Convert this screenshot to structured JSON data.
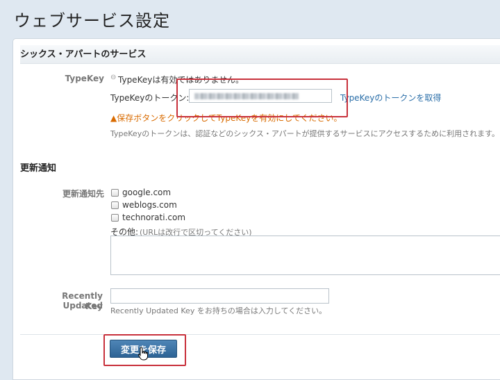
{
  "page": {
    "title": "ウェブサービス設定"
  },
  "six_apart": {
    "section_title": "シックス・アパートのサービス",
    "typekey_label": "TypeKey",
    "status_text": "TypeKeyは有効ではありません。",
    "token_label": "TypeKeyのトークン:",
    "get_token_link": "TypeKeyのトークンを取得",
    "warning": "▲保存ボタンをクリックしてTypeKeyを有効にしてください。",
    "description": "TypeKeyのトークンは、認証などのシックス・アパートが提供するサービスにアクセスするために利用されます。"
  },
  "update_ping": {
    "section_title": "更新通知",
    "services_label": "更新通知先",
    "services": [
      {
        "label": "google.com",
        "checked": false
      },
      {
        "label": "weblogs.com",
        "checked": false
      },
      {
        "label": "technorati.com",
        "checked": false
      }
    ],
    "other_label": "その他:",
    "other_hint": "(URLは改行で区切ってください)",
    "recently_updated_label_1": "Recently Updated",
    "recently_updated_label_2": "Key",
    "recently_updated_hint": "Recently Updated Key をお持ちの場合は入力してください。"
  },
  "actions": {
    "save_label": "変更を保存"
  },
  "colors": {
    "accent": "#2d6395",
    "warning": "#d96b00",
    "link": "#2a6ea8",
    "callout": "#c8303b"
  }
}
